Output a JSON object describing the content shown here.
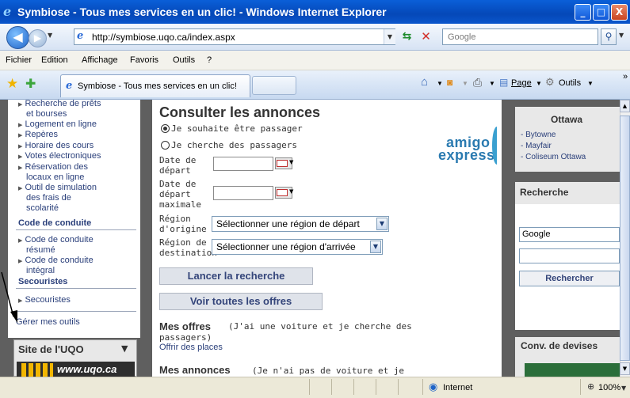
{
  "window": {
    "title": "Symbiose - Tous mes services en un clic! - Windows Internet Explorer",
    "controls": [
      "_",
      "□",
      "X"
    ]
  },
  "address_bar": {
    "url": "http://symbiose.uqo.ca/index.aspx",
    "search_placeholder": "Google"
  },
  "menu": [
    "Fichier",
    "Edition",
    "Affichage",
    "Favoris",
    "Outils",
    "?"
  ],
  "tab": {
    "label": "Symbiose - Tous mes services en un clic!"
  },
  "command_bar": {
    "page": "Page",
    "tools": "Outils",
    "more": "»"
  },
  "left_nav": {
    "items_top": [
      "Recherche de prêts",
      "et bourses",
      "Logement en ligne",
      "Repères",
      "Horaire des cours",
      "Votes électroniques",
      "Réservation des",
      "locaux en ligne",
      "Outil de simulation",
      "des frais de",
      "scolarité"
    ],
    "section_code": "Code de conduite",
    "items_code": [
      "Code de conduite",
      "résumé",
      "Code de conduite",
      "intégral"
    ],
    "section_secouristes": "Secouristes",
    "item_secouristes": "Secouristes",
    "manage_tools": "Gérer mes outils",
    "uqo_box_title": "Site de l'UQO",
    "uqo_url": "www.uqo.ca"
  },
  "main": {
    "title": "Consulter les annonces",
    "radio_passenger": "Je souhaite être passager",
    "radio_driver": "Je cherche des passagers",
    "date_label_1": "Date de",
    "date_label_2": "départ",
    "date_max_1": "Date de",
    "date_max_2": "départ",
    "date_max_3": "maximale",
    "origin_label_1": "Région",
    "origin_label_2": "d'origine",
    "origin_select": "Sélectionner une région de départ",
    "dest_label_1": "Région de",
    "dest_label_2": "destination",
    "dest_select": "Sélectionner une région d'arrivée",
    "btn_search": "Lancer la recherche",
    "btn_all": "Voir toutes les offres",
    "offers_title": "Mes offres",
    "offers_note": "(J'ai une voiture et je cherche des",
    "offers_note_2": "passagers)",
    "offer_link": "Offrir des places",
    "ads_title": "Mes annonces",
    "ads_note": "(Je n'ai pas de voiture et je"
  },
  "logo": {
    "line1": "amigo",
    "line2": "express"
  },
  "right_col": {
    "ottawa_title": "Ottawa",
    "ottawa_items": [
      "- Bytowne",
      "- Mayfair",
      "- Coliseum Ottawa"
    ],
    "search_title": "Recherche",
    "search_engine": "Google",
    "search_button": "Rechercher",
    "currency_title": "Conv. de devises"
  },
  "status_bar": {
    "zone": "Internet",
    "zoom": "100%"
  }
}
